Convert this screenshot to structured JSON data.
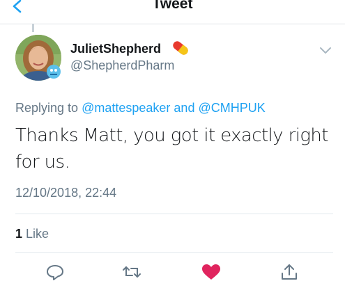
{
  "header": {
    "title": "Tweet"
  },
  "tweet": {
    "display_name": "JulietShepherd",
    "handle": "@ShepherdPharm",
    "replying_prefix": "Replying to",
    "replying_user_1": "@mattespeaker",
    "replying_and": "and",
    "replying_user_2": "@CMHPUK",
    "text": "Thanks Matt, you got it exactly right for us.",
    "timestamp": "12/10/2018, 22:44",
    "like_count": "1",
    "like_label": "Like",
    "liked": true
  },
  "icons": {
    "back": "chevron-left-icon",
    "name_emoji": "pill-icon",
    "menu": "chevron-down-icon",
    "reply": "reply-icon",
    "retweet": "retweet-icon",
    "like": "heart-icon",
    "share": "share-icon"
  },
  "colors": {
    "accent": "#1da1f2",
    "like": "#e0245e",
    "secondary_text": "#657786",
    "primary_text": "#14171a"
  }
}
